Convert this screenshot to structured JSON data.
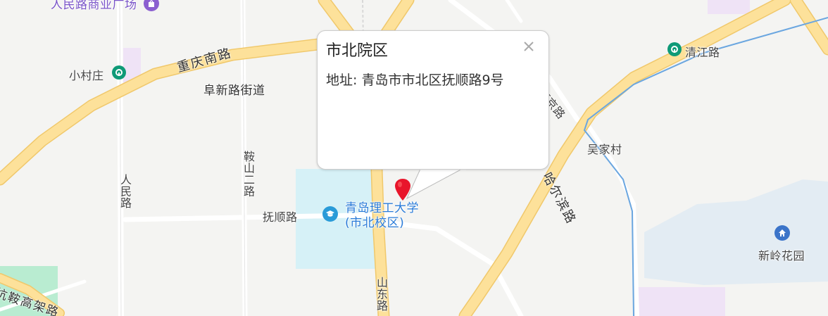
{
  "map": {
    "labels": {
      "renmin_mall": "人民路商业广场",
      "chongqing_s_road": "重庆南路",
      "xiaocunzhuang": "小村庄",
      "fuxinlu_street": "阜新路街道",
      "anshan_road": "鞍山二路",
      "renmin_road": "人民路",
      "fushun_road": "抚顺路",
      "university_line1": "青岛理工大学",
      "university_line2": "(市北校区)",
      "shandong_road": "山东路",
      "harbin_road": "哈尔滨路",
      "nanjing_road": "南京路",
      "wujiacun": "吴家村",
      "qingjiang_road": "清江路",
      "xinling_garden": "新岭花园",
      "elevated_road": "杭鞍高架路"
    },
    "colors": {
      "background": "#f4f4f2",
      "road_main": "#fde19a",
      "road_minor": "#ffffff",
      "campus": "#d6f1f7",
      "park": "#b9ecd1",
      "poi_blue": "#2a7bd8",
      "metro_green": "#0e9a77",
      "marker_red": "#e8152b"
    }
  },
  "popup": {
    "title": "市北院区",
    "address": "地址: 青岛市市北区抚顺路9号"
  }
}
